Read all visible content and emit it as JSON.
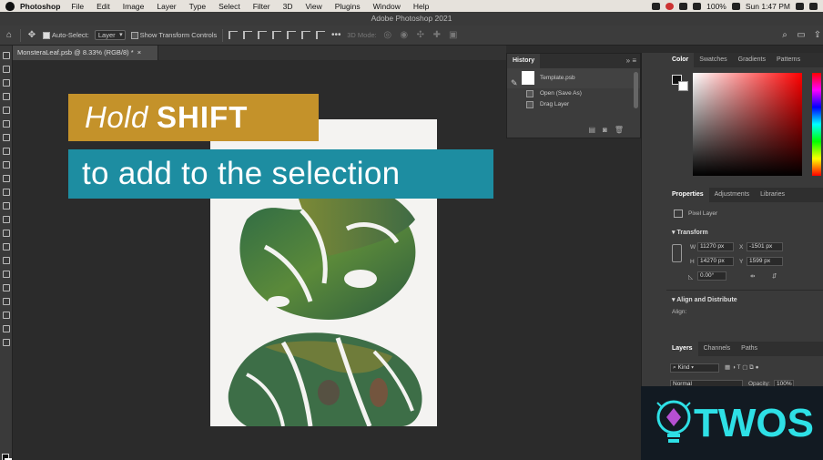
{
  "menubar": {
    "app": "Photoshop",
    "menus": [
      "File",
      "Edit",
      "Image",
      "Layer",
      "Type",
      "Select",
      "Filter",
      "3D",
      "View",
      "Plugins",
      "Window",
      "Help"
    ],
    "battery": "100%",
    "clock": "Sun 1:47 PM"
  },
  "window": {
    "title": "Adobe Photoshop 2021"
  },
  "options": {
    "auto_select_label": "Auto-Select:",
    "auto_select_value": "Layer",
    "show_transform_label": "Show Transform Controls",
    "mode_3d_label": "3D Mode:"
  },
  "document": {
    "tab_label": "MonsteraLeaf.psb @ 8.33% (RGB/8) *"
  },
  "overlay": {
    "line1_light": "Hold",
    "line1_bold": "SHIFT",
    "line2": "to add to the selection",
    "colors": {
      "gold": "#c4922a",
      "teal": "#1d8da1"
    }
  },
  "history": {
    "tab": "History",
    "snapshot": "Template.psb",
    "steps": [
      "Open (Save As)",
      "Drag Layer"
    ]
  },
  "color_panel": {
    "tabs": [
      "Color",
      "Swatches",
      "Gradients",
      "Patterns"
    ]
  },
  "properties": {
    "tabs": [
      "Properties",
      "Adjustments",
      "Libraries"
    ],
    "layer_kind": "Pixel Layer",
    "transform_title": "Transform",
    "w_label": "W",
    "w": "11270 px",
    "x_label": "X",
    "x": "-1501 px",
    "h_label": "H",
    "h": "14270 px",
    "y_label": "Y",
    "y": "1599 px",
    "angle": "0.00°",
    "align_title": "Align and Distribute",
    "align_label": "Align:"
  },
  "layers": {
    "tabs": [
      "Layers",
      "Channels",
      "Paths"
    ],
    "filter": "Kind",
    "blend_mode": "Normal",
    "opacity_label": "Opacity:",
    "opacity": "100%"
  },
  "watermark": {
    "text": "TWOS"
  }
}
